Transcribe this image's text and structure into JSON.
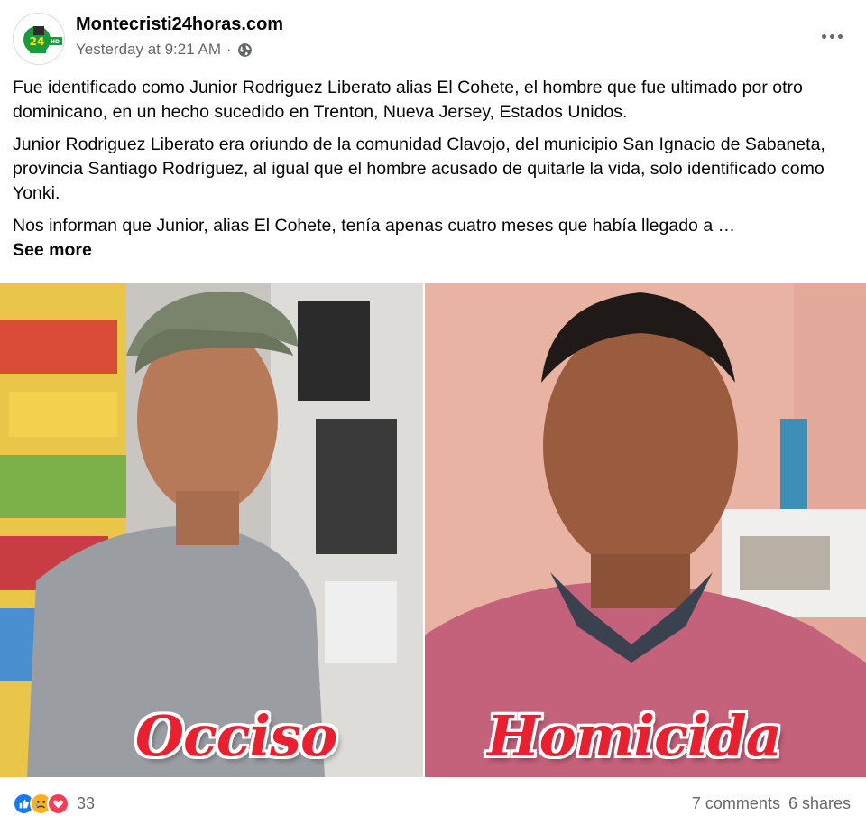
{
  "header": {
    "page_name": "Montecristi24horas.com",
    "timestamp": "Yesterday at 9:21 AM",
    "separator": "·",
    "privacy_icon": "globe-icon",
    "more_icon": "more-horizontal-icon",
    "avatar_text": "24"
  },
  "post": {
    "paragraphs": [
      "Fue identificado como Junior Rodriguez Liberato alias El Cohete, el hombre que fue ultimado por otro dominicano, en un hecho sucedido en Trenton, Nueva Jersey, Estados Unidos.",
      "Junior Rodriguez Liberato era oriundo de la comunidad Clavojo, del municipio San Ignacio de Sabaneta, provincia Santiago Rodríguez, al igual que el hombre acusado de quitarle la vida, solo identificado como Yonki.",
      "Nos informan que Junior, alias El Cohete, tenía apenas cuatro meses que había llegado a …"
    ],
    "see_more": "See more"
  },
  "photo": {
    "left_caption": "Occiso",
    "right_caption": "Homicida"
  },
  "footer": {
    "reaction_icons": [
      "like-icon",
      "sad-icon",
      "love-icon"
    ],
    "reaction_count": "33",
    "comments": "7 comments",
    "shares": "6 shares"
  },
  "colors": {
    "caption_red": "#e8202f",
    "like_blue": "#1877f2",
    "love_red": "#f33e58",
    "sad_yellow": "#f7b125",
    "secondary_text": "#65676b"
  }
}
